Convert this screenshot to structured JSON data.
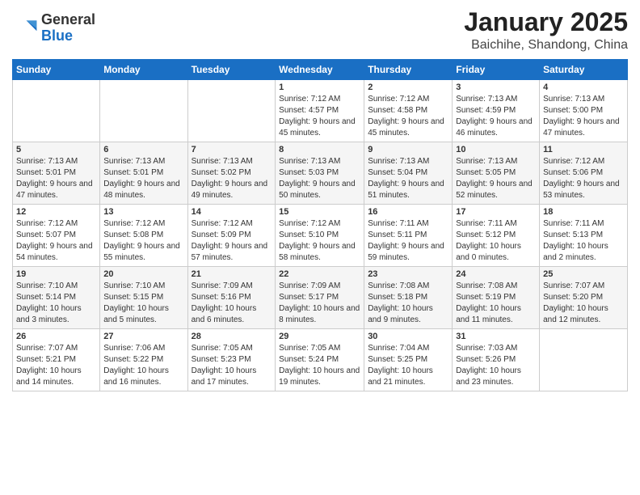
{
  "header": {
    "logo_general": "General",
    "logo_blue": "Blue",
    "month": "January 2025",
    "location": "Baichihe, Shandong, China"
  },
  "weekdays": [
    "Sunday",
    "Monday",
    "Tuesday",
    "Wednesday",
    "Thursday",
    "Friday",
    "Saturday"
  ],
  "weeks": [
    [
      {
        "day": "",
        "info": ""
      },
      {
        "day": "",
        "info": ""
      },
      {
        "day": "",
        "info": ""
      },
      {
        "day": "1",
        "info": "Sunrise: 7:12 AM\nSunset: 4:57 PM\nDaylight: 9 hours and 45 minutes."
      },
      {
        "day": "2",
        "info": "Sunrise: 7:12 AM\nSunset: 4:58 PM\nDaylight: 9 hours and 45 minutes."
      },
      {
        "day": "3",
        "info": "Sunrise: 7:13 AM\nSunset: 4:59 PM\nDaylight: 9 hours and 46 minutes."
      },
      {
        "day": "4",
        "info": "Sunrise: 7:13 AM\nSunset: 5:00 PM\nDaylight: 9 hours and 47 minutes."
      }
    ],
    [
      {
        "day": "5",
        "info": "Sunrise: 7:13 AM\nSunset: 5:01 PM\nDaylight: 9 hours and 47 minutes."
      },
      {
        "day": "6",
        "info": "Sunrise: 7:13 AM\nSunset: 5:01 PM\nDaylight: 9 hours and 48 minutes."
      },
      {
        "day": "7",
        "info": "Sunrise: 7:13 AM\nSunset: 5:02 PM\nDaylight: 9 hours and 49 minutes."
      },
      {
        "day": "8",
        "info": "Sunrise: 7:13 AM\nSunset: 5:03 PM\nDaylight: 9 hours and 50 minutes."
      },
      {
        "day": "9",
        "info": "Sunrise: 7:13 AM\nSunset: 5:04 PM\nDaylight: 9 hours and 51 minutes."
      },
      {
        "day": "10",
        "info": "Sunrise: 7:13 AM\nSunset: 5:05 PM\nDaylight: 9 hours and 52 minutes."
      },
      {
        "day": "11",
        "info": "Sunrise: 7:12 AM\nSunset: 5:06 PM\nDaylight: 9 hours and 53 minutes."
      }
    ],
    [
      {
        "day": "12",
        "info": "Sunrise: 7:12 AM\nSunset: 5:07 PM\nDaylight: 9 hours and 54 minutes."
      },
      {
        "day": "13",
        "info": "Sunrise: 7:12 AM\nSunset: 5:08 PM\nDaylight: 9 hours and 55 minutes."
      },
      {
        "day": "14",
        "info": "Sunrise: 7:12 AM\nSunset: 5:09 PM\nDaylight: 9 hours and 57 minutes."
      },
      {
        "day": "15",
        "info": "Sunrise: 7:12 AM\nSunset: 5:10 PM\nDaylight: 9 hours and 58 minutes."
      },
      {
        "day": "16",
        "info": "Sunrise: 7:11 AM\nSunset: 5:11 PM\nDaylight: 9 hours and 59 minutes."
      },
      {
        "day": "17",
        "info": "Sunrise: 7:11 AM\nSunset: 5:12 PM\nDaylight: 10 hours and 0 minutes."
      },
      {
        "day": "18",
        "info": "Sunrise: 7:11 AM\nSunset: 5:13 PM\nDaylight: 10 hours and 2 minutes."
      }
    ],
    [
      {
        "day": "19",
        "info": "Sunrise: 7:10 AM\nSunset: 5:14 PM\nDaylight: 10 hours and 3 minutes."
      },
      {
        "day": "20",
        "info": "Sunrise: 7:10 AM\nSunset: 5:15 PM\nDaylight: 10 hours and 5 minutes."
      },
      {
        "day": "21",
        "info": "Sunrise: 7:09 AM\nSunset: 5:16 PM\nDaylight: 10 hours and 6 minutes."
      },
      {
        "day": "22",
        "info": "Sunrise: 7:09 AM\nSunset: 5:17 PM\nDaylight: 10 hours and 8 minutes."
      },
      {
        "day": "23",
        "info": "Sunrise: 7:08 AM\nSunset: 5:18 PM\nDaylight: 10 hours and 9 minutes."
      },
      {
        "day": "24",
        "info": "Sunrise: 7:08 AM\nSunset: 5:19 PM\nDaylight: 10 hours and 11 minutes."
      },
      {
        "day": "25",
        "info": "Sunrise: 7:07 AM\nSunset: 5:20 PM\nDaylight: 10 hours and 12 minutes."
      }
    ],
    [
      {
        "day": "26",
        "info": "Sunrise: 7:07 AM\nSunset: 5:21 PM\nDaylight: 10 hours and 14 minutes."
      },
      {
        "day": "27",
        "info": "Sunrise: 7:06 AM\nSunset: 5:22 PM\nDaylight: 10 hours and 16 minutes."
      },
      {
        "day": "28",
        "info": "Sunrise: 7:05 AM\nSunset: 5:23 PM\nDaylight: 10 hours and 17 minutes."
      },
      {
        "day": "29",
        "info": "Sunrise: 7:05 AM\nSunset: 5:24 PM\nDaylight: 10 hours and 19 minutes."
      },
      {
        "day": "30",
        "info": "Sunrise: 7:04 AM\nSunset: 5:25 PM\nDaylight: 10 hours and 21 minutes."
      },
      {
        "day": "31",
        "info": "Sunrise: 7:03 AM\nSunset: 5:26 PM\nDaylight: 10 hours and 23 minutes."
      },
      {
        "day": "",
        "info": ""
      }
    ]
  ]
}
